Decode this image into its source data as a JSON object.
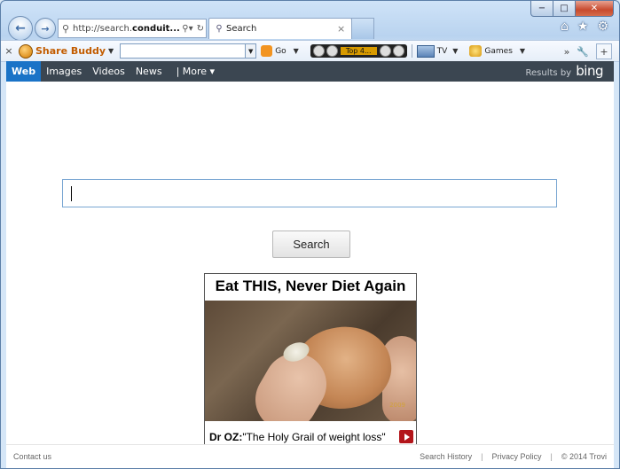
{
  "browser": {
    "address_url_prefix": "http://search.",
    "address_url_bold": "conduit...",
    "tab_label": "Search",
    "tab_close": "×",
    "window_controls": {
      "minimize": "−",
      "maximize": "□",
      "close": "✕"
    },
    "right_icons": [
      "home-icon",
      "star-icon",
      "gear-icon"
    ]
  },
  "toolbar": {
    "close": "×",
    "brand_name": "Share Buddy",
    "go_label": "Go",
    "radio_label": "Top 4...",
    "tv_label": "TV",
    "games_label": "Games",
    "more_chevron": "»"
  },
  "sitenav": {
    "items": [
      "Web",
      "Images",
      "Videos",
      "News",
      "| More ▾"
    ],
    "active_index": 0,
    "results_by": "Results by",
    "results_brand": "bing"
  },
  "search": {
    "input_value": "",
    "button_label": "Search"
  },
  "ad": {
    "headline": "Eat THIS, Never Diet Again",
    "caption_bold": "Dr OZ:",
    "caption_rest": "\"The Holy Grail of weight loss\"",
    "photo_stamp": "2009"
  },
  "footer": {
    "contact": "Contact us",
    "history": "Search History",
    "privacy": "Privacy Policy",
    "copyright": "© 2014 Trovi",
    "sep": "|"
  },
  "colors": {
    "nav_bar": "#3b4651",
    "nav_active": "#1a73c7",
    "brand_orange": "#c25c00",
    "search_border": "#79a6d2"
  }
}
